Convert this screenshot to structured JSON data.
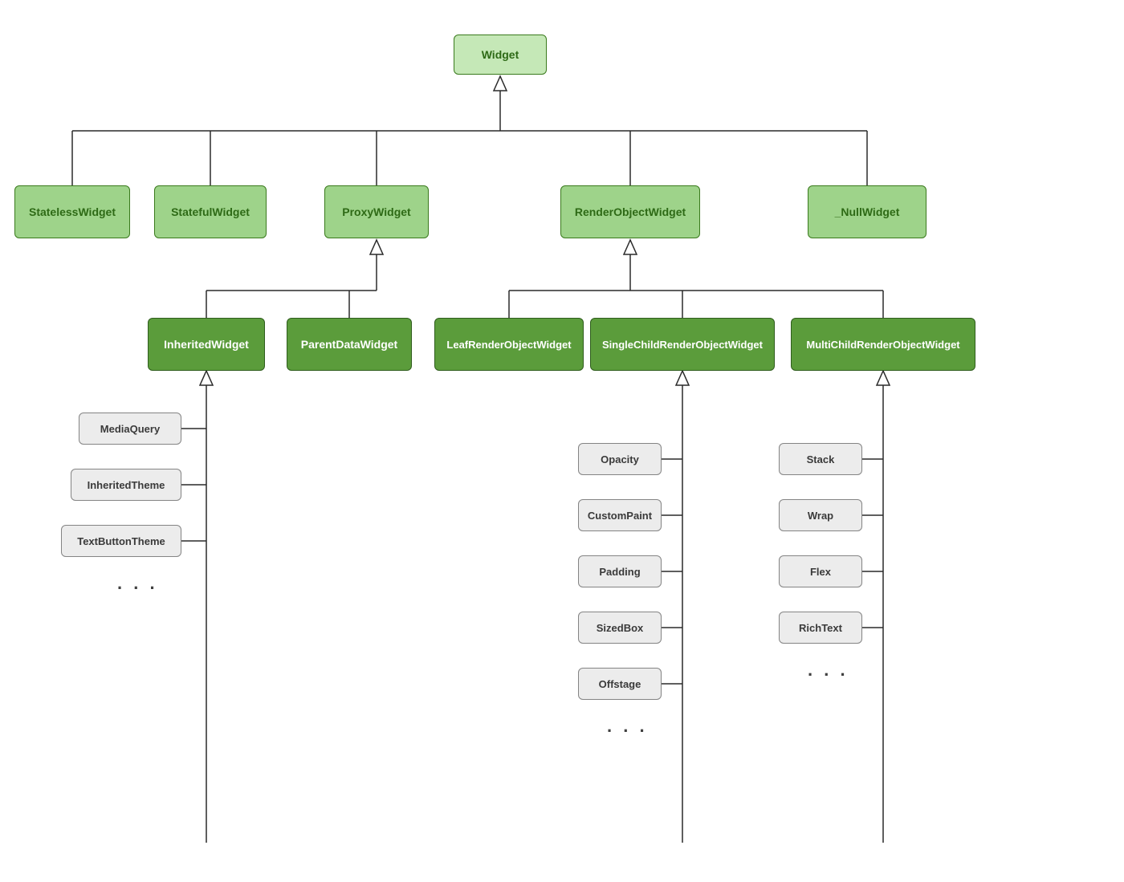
{
  "colors": {
    "root_fill": "#c5e8b7",
    "tier1_fill": "#9ed38a",
    "tier2_fill": "#5b9c3b",
    "leaf_fill": "#ececec",
    "border_green": "#3a7a1d",
    "border_grey": "#848484"
  },
  "root": {
    "label": "Widget"
  },
  "tier1": {
    "stateless": {
      "label": "StatelessWidget"
    },
    "stateful": {
      "label": "StatefulWidget"
    },
    "proxy": {
      "label": "ProxyWidget"
    },
    "renderobj": {
      "label": "RenderObjectWidget"
    },
    "nullw": {
      "label": "_NullWidget"
    }
  },
  "tier2": {
    "inherited": {
      "label": "InheritedWidget"
    },
    "parentdata": {
      "label": "ParentDataWidget"
    },
    "leafrender": {
      "label": "LeafRenderObjectWidget"
    },
    "singlechild": {
      "label": "SingleChildRenderObjectWidget"
    },
    "multichild": {
      "label": "MultiChildRenderObjectWidget"
    }
  },
  "leaves": {
    "inherited": [
      "MediaQuery",
      "InheritedTheme",
      "TextButtonTheme"
    ],
    "singlechild": [
      "Opacity",
      "CustomPaint",
      "Padding",
      "SizedBox",
      "Offstage"
    ],
    "multichild": [
      "Stack",
      "Wrap",
      "Flex",
      "RichText"
    ]
  },
  "ellipsis": ". . ."
}
